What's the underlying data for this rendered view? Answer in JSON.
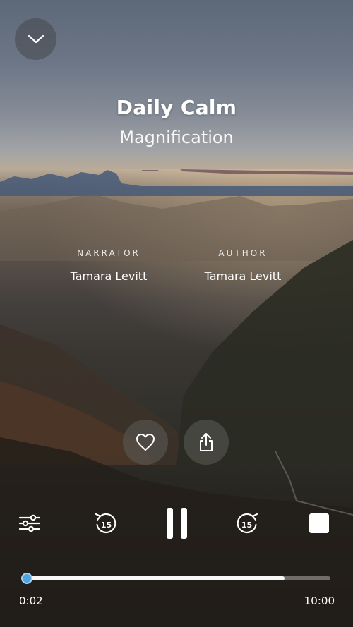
{
  "track": {
    "title": "Daily Calm",
    "subtitle": "Magnification"
  },
  "credits": {
    "narrator_label": "NARRATOR",
    "narrator_name": "Tamara Levitt",
    "author_label": "AUTHOR",
    "author_name": "Tamara Levitt"
  },
  "controls": {
    "collapse_icon": "chevron-down-icon",
    "favorite_icon": "heart-icon",
    "share_icon": "share-icon",
    "settings_icon": "sliders-icon",
    "rewind_icon": "rewind-15-icon",
    "rewind_seconds": "15",
    "playpause_icon": "pause-icon",
    "forward_icon": "forward-15-icon",
    "forward_seconds": "15",
    "stop_icon": "stop-icon"
  },
  "playback": {
    "elapsed": "0:02",
    "total": "10:00",
    "progress": 0.0033,
    "buffered": 0.85,
    "accent_color": "#4fa3e0"
  }
}
